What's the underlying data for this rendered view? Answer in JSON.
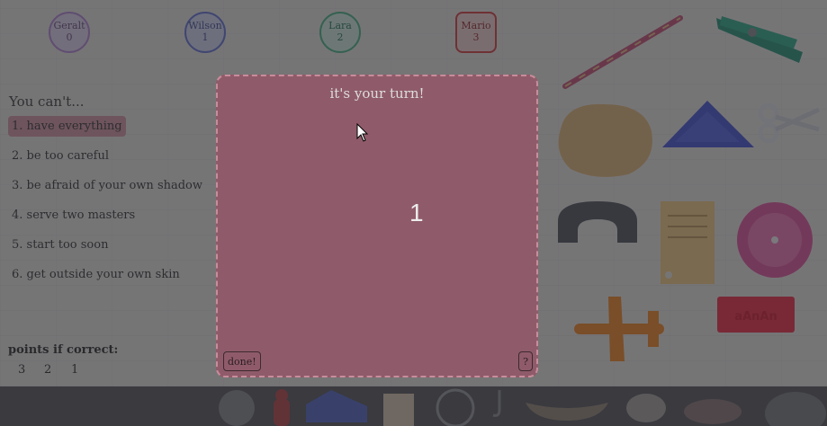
{
  "players": [
    {
      "name": "Geralt",
      "score": "0",
      "color": "#b58ad6",
      "fill": "#e2d6ee"
    },
    {
      "name": "Wilson",
      "score": "1",
      "color": "#6a78d6",
      "fill": "#d5d9f2"
    },
    {
      "name": "Lara",
      "score": "2",
      "color": "#4fb88a",
      "fill": "#d4eee2"
    },
    {
      "name": "Mario",
      "score": "3",
      "color": "#d64545",
      "fill": "#f2d4d4"
    }
  ],
  "card": {
    "title": "You can't...",
    "options": [
      "1. have everything",
      "2. be too careful",
      "3. be afraid of your own shadow",
      "4. serve two masters",
      "5. start too soon",
      "6. get outside your own skin"
    ],
    "selected_index": 0,
    "points_label": "points if correct:",
    "points": [
      "3",
      "2",
      "1"
    ]
  },
  "turn": {
    "text": "it's your turn!",
    "counter": "1",
    "done_label": "done!",
    "help_label": "?"
  },
  "items": [
    {
      "name": "pencil"
    },
    {
      "name": "clothespin"
    },
    {
      "name": "sponge"
    },
    {
      "name": "triangle"
    },
    {
      "name": "scissors"
    },
    {
      "name": "tunnel-block"
    },
    {
      "name": "ticket"
    },
    {
      "name": "flower"
    },
    {
      "name": "airplane"
    },
    {
      "name": "eraser",
      "label": "aAnAn"
    }
  ],
  "tray_items": [
    "coin",
    "chess-piece",
    "shoe",
    "puzzle-piece",
    "ring",
    "hook",
    "canoe",
    "bowl",
    "frog",
    "stone"
  ]
}
